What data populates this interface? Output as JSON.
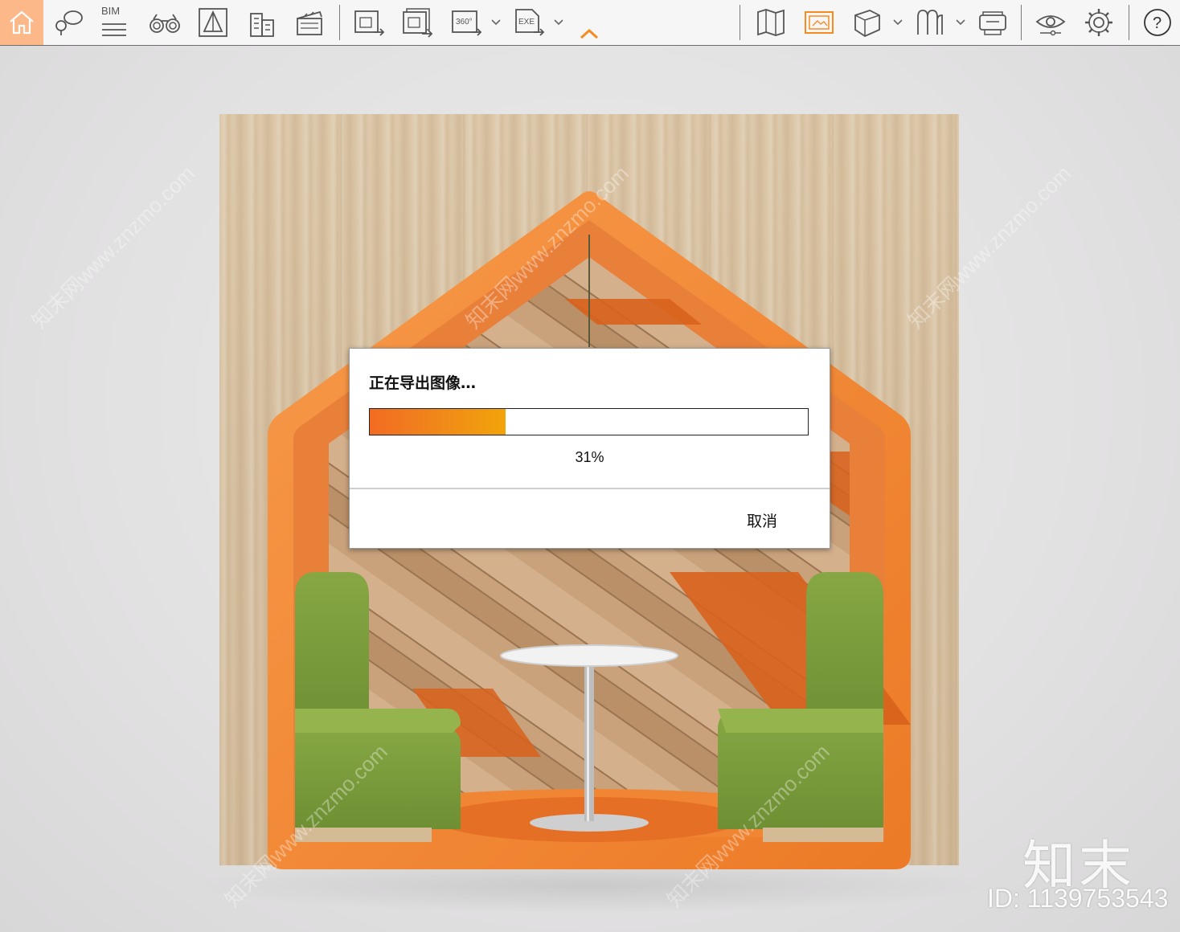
{
  "toolbar": {
    "bim_label": "BIM",
    "icons": {
      "home": "home-icon",
      "location": "location-icon",
      "bim": "bim-icon",
      "binoculars": "binoculars-icon",
      "perspective": "perspective-icon",
      "buildings": "buildings-icon",
      "clapper": "clapper-icon",
      "export_image": "export-image-icon",
      "export_batch": "export-batch-icon",
      "export_360": "export-360-icon",
      "export_exe": "export-exe-icon",
      "collapse": "chevron-up-icon",
      "map": "map-icon",
      "gallery": "gallery-icon",
      "cube": "cube-icon",
      "assets": "assets-icon",
      "vr": "vr-headset-icon",
      "visibility": "eye-icon",
      "settings": "gear-icon",
      "help": "help-icon"
    },
    "accent_color": "#f68b1f",
    "active_bg": "#fdb88a"
  },
  "dialog": {
    "title": "正在导出图像…",
    "progress_value": 0.31,
    "progress_text": "31%",
    "cancel_label": "取消"
  },
  "watermark": {
    "logo_text": "知末",
    "id_text": "ID: 1139753543",
    "diagonal_text": "知末网www.znzmo.com"
  },
  "colors": {
    "booth_orange": "#f0812d",
    "seat_green": "#7a9a3a",
    "wood": "#d6c1a1"
  }
}
